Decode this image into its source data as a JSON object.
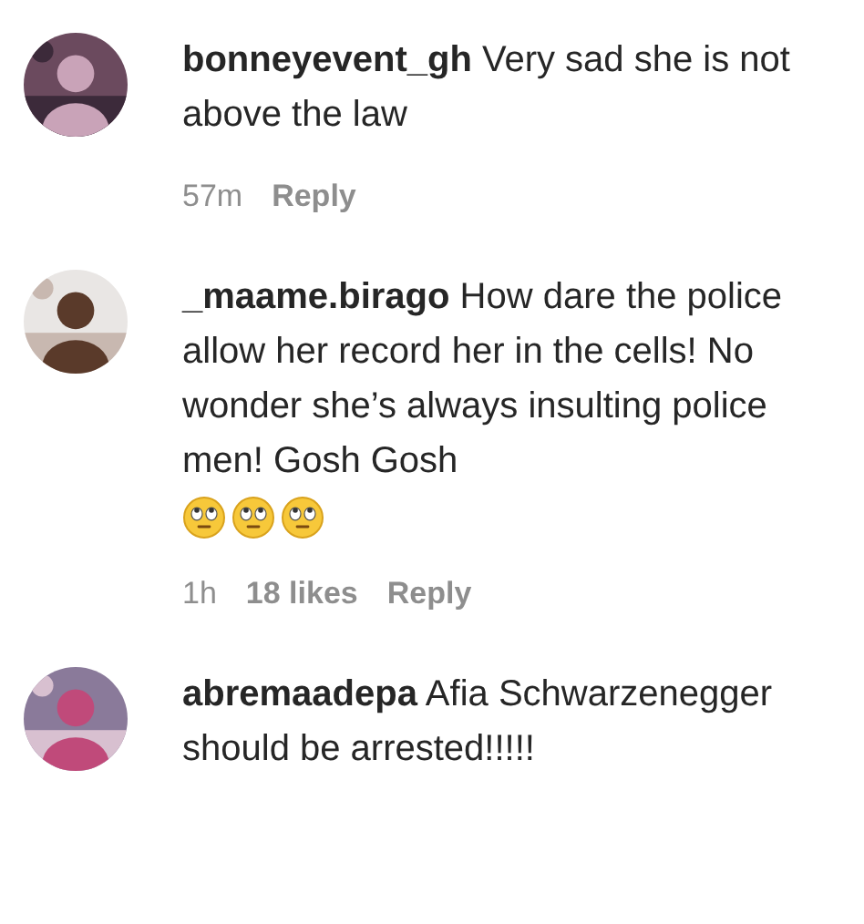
{
  "comments": [
    {
      "username": "bonneyevent_gh",
      "text": "Very sad she is not above the law",
      "time": "57m",
      "reply": "Reply"
    },
    {
      "username": "_maame.birago",
      "text": "How dare the police allow her record her in the cells! No wonder she’s always insulting police men! Gosh Gosh",
      "emojis": [
        {
          "kind": "rolling-eyes"
        },
        {
          "kind": "rolling-eyes"
        },
        {
          "kind": "rolling-eyes"
        }
      ],
      "time": "1h",
      "likes": "18 likes",
      "reply": "Reply"
    },
    {
      "username": "abremaadepa",
      "text": "Afia Schwarzenegger should be arrested!!!!!"
    }
  ]
}
